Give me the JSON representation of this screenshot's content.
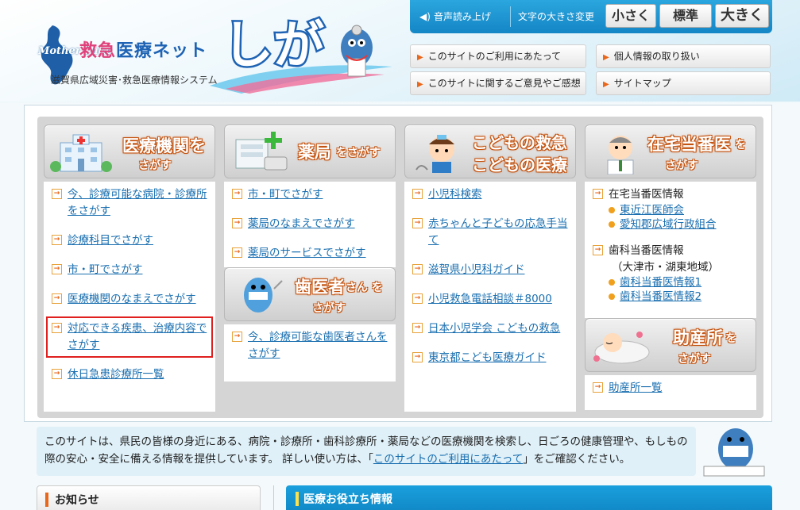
{
  "header": {
    "logo_lake_text": "Mother Lake",
    "site_name_part1": "救急",
    "site_name_part2": "医療ネット",
    "site_name_shiga": "しが",
    "subtitle": "滋賀県広域災害･救急医療情報システム",
    "speak_label": "音声読み上げ",
    "font_size_label": "文字の大きさ変更",
    "font_small": "小さく",
    "font_normal": "標準",
    "font_large": "大きく",
    "links": [
      "このサイトのご利用にあたって",
      "個人情報の取り扱い",
      "このサイトに関するご意見やご感想",
      "サイトマップ"
    ]
  },
  "columns": {
    "hospital": {
      "title_main": "医療機関を",
      "title_sub": "さがす",
      "items": [
        "今、診療可能な病院・診療所をさがす",
        "診療科目でさがす",
        "市・町でさがす",
        "医療機関のなまえでさがす",
        "対応できる疾患、治療内容でさがす",
        "休日急患診療所一覧"
      ]
    },
    "pharmacy": {
      "title_main": "薬局",
      "title_suffix": "をさがす",
      "items": [
        "市・町でさがす",
        "薬局のなまえでさがす",
        "薬局のサービスでさがす"
      ]
    },
    "dentist": {
      "title_main": "歯医者",
      "title_suffix": "さん を",
      "title_sub": "さがす",
      "items": [
        "今、診療可能な歯医者さんをさがす"
      ]
    },
    "children": {
      "title_line1": "こどもの救急",
      "title_line2": "こどもの医療",
      "items": [
        "小児科検索",
        "赤ちゃんと子どもの応急手当て",
        "滋賀県小児科ガイド",
        "小児救急電話相談＃8000",
        "日本小児学会 こどもの救急",
        "東京都こども医療ガイド"
      ]
    },
    "home_duty": {
      "title_main": "在宅当番医",
      "title_suffix": "を",
      "title_sub": "さがす",
      "group1_label": "在宅当番医情報",
      "group1_links": [
        "東近江医師会",
        "愛知郡広域行政組合"
      ],
      "group2_label": "歯科当番医情報",
      "group2_note": "（大津市・湖東地域）",
      "group2_links": [
        "歯科当番医情報1",
        "歯科当番医情報2"
      ]
    },
    "midwife": {
      "title_main": "助産所",
      "title_suffix": "を",
      "title_sub": "さがす",
      "items": [
        "助産所一覧"
      ]
    }
  },
  "info": {
    "text_before": "このサイトは、県民の皆様の身近にある、病院・診療所・歯科診療所・薬局などの医療機関を検索し、日ごろの健康管理や、もしもの際の安心・安全に備える情報を提供しています。 詳しい使い方は、「",
    "link": "このサイトのご利用にあたって",
    "text_after": "」をご確認ください。"
  },
  "bottom": {
    "news_label": "お知らせ",
    "useful_label": "医療お役立ち情報"
  },
  "colors": {
    "accent_blue": "#1486c6",
    "accent_orange": "#e8671a",
    "link": "#1a6fb0",
    "highlight_box": "#e0201e"
  }
}
